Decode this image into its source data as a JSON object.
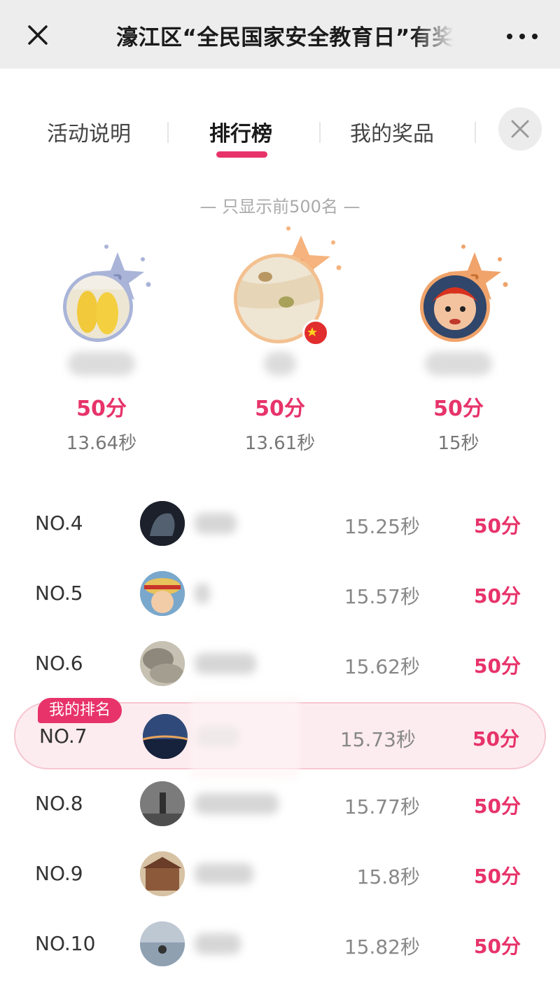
{
  "nav": {
    "title": "濠江区“全民国家安全教育日”有奖",
    "close_icon": "close-icon",
    "more_icon": "more-dots-icon"
  },
  "tabs": [
    {
      "label": "活动说明",
      "active": false
    },
    {
      "label": "排行榜",
      "active": true
    },
    {
      "label": "我的奖品",
      "active": false
    }
  ],
  "notice": "— 只显示前500名 —",
  "podium": [
    {
      "place": "2",
      "score": "50分",
      "time": "13.64秒"
    },
    {
      "place": "1",
      "score": "50分",
      "time": "13.61秒"
    },
    {
      "place": "3",
      "score": "50分",
      "time": "15秒"
    }
  ],
  "my_rank_badge": "我的排名",
  "rows": [
    {
      "rank": "NO.4",
      "time": "15.25秒",
      "score": "50分"
    },
    {
      "rank": "NO.5",
      "time": "15.57秒",
      "score": "50分"
    },
    {
      "rank": "NO.6",
      "time": "15.62秒",
      "score": "50分"
    },
    {
      "rank": "NO.7",
      "time": "15.73秒",
      "score": "50分",
      "mine": true
    },
    {
      "rank": "NO.8",
      "time": "15.77秒",
      "score": "50分"
    },
    {
      "rank": "NO.9",
      "time": "15.8秒",
      "score": "50分"
    },
    {
      "rank": "NO.10",
      "time": "15.82秒",
      "score": "50分"
    }
  ],
  "colors": {
    "accent": "#e7336a",
    "gold": "#f0b27a",
    "silver": "#a9b4d8",
    "bronze": "#f0a36a"
  }
}
